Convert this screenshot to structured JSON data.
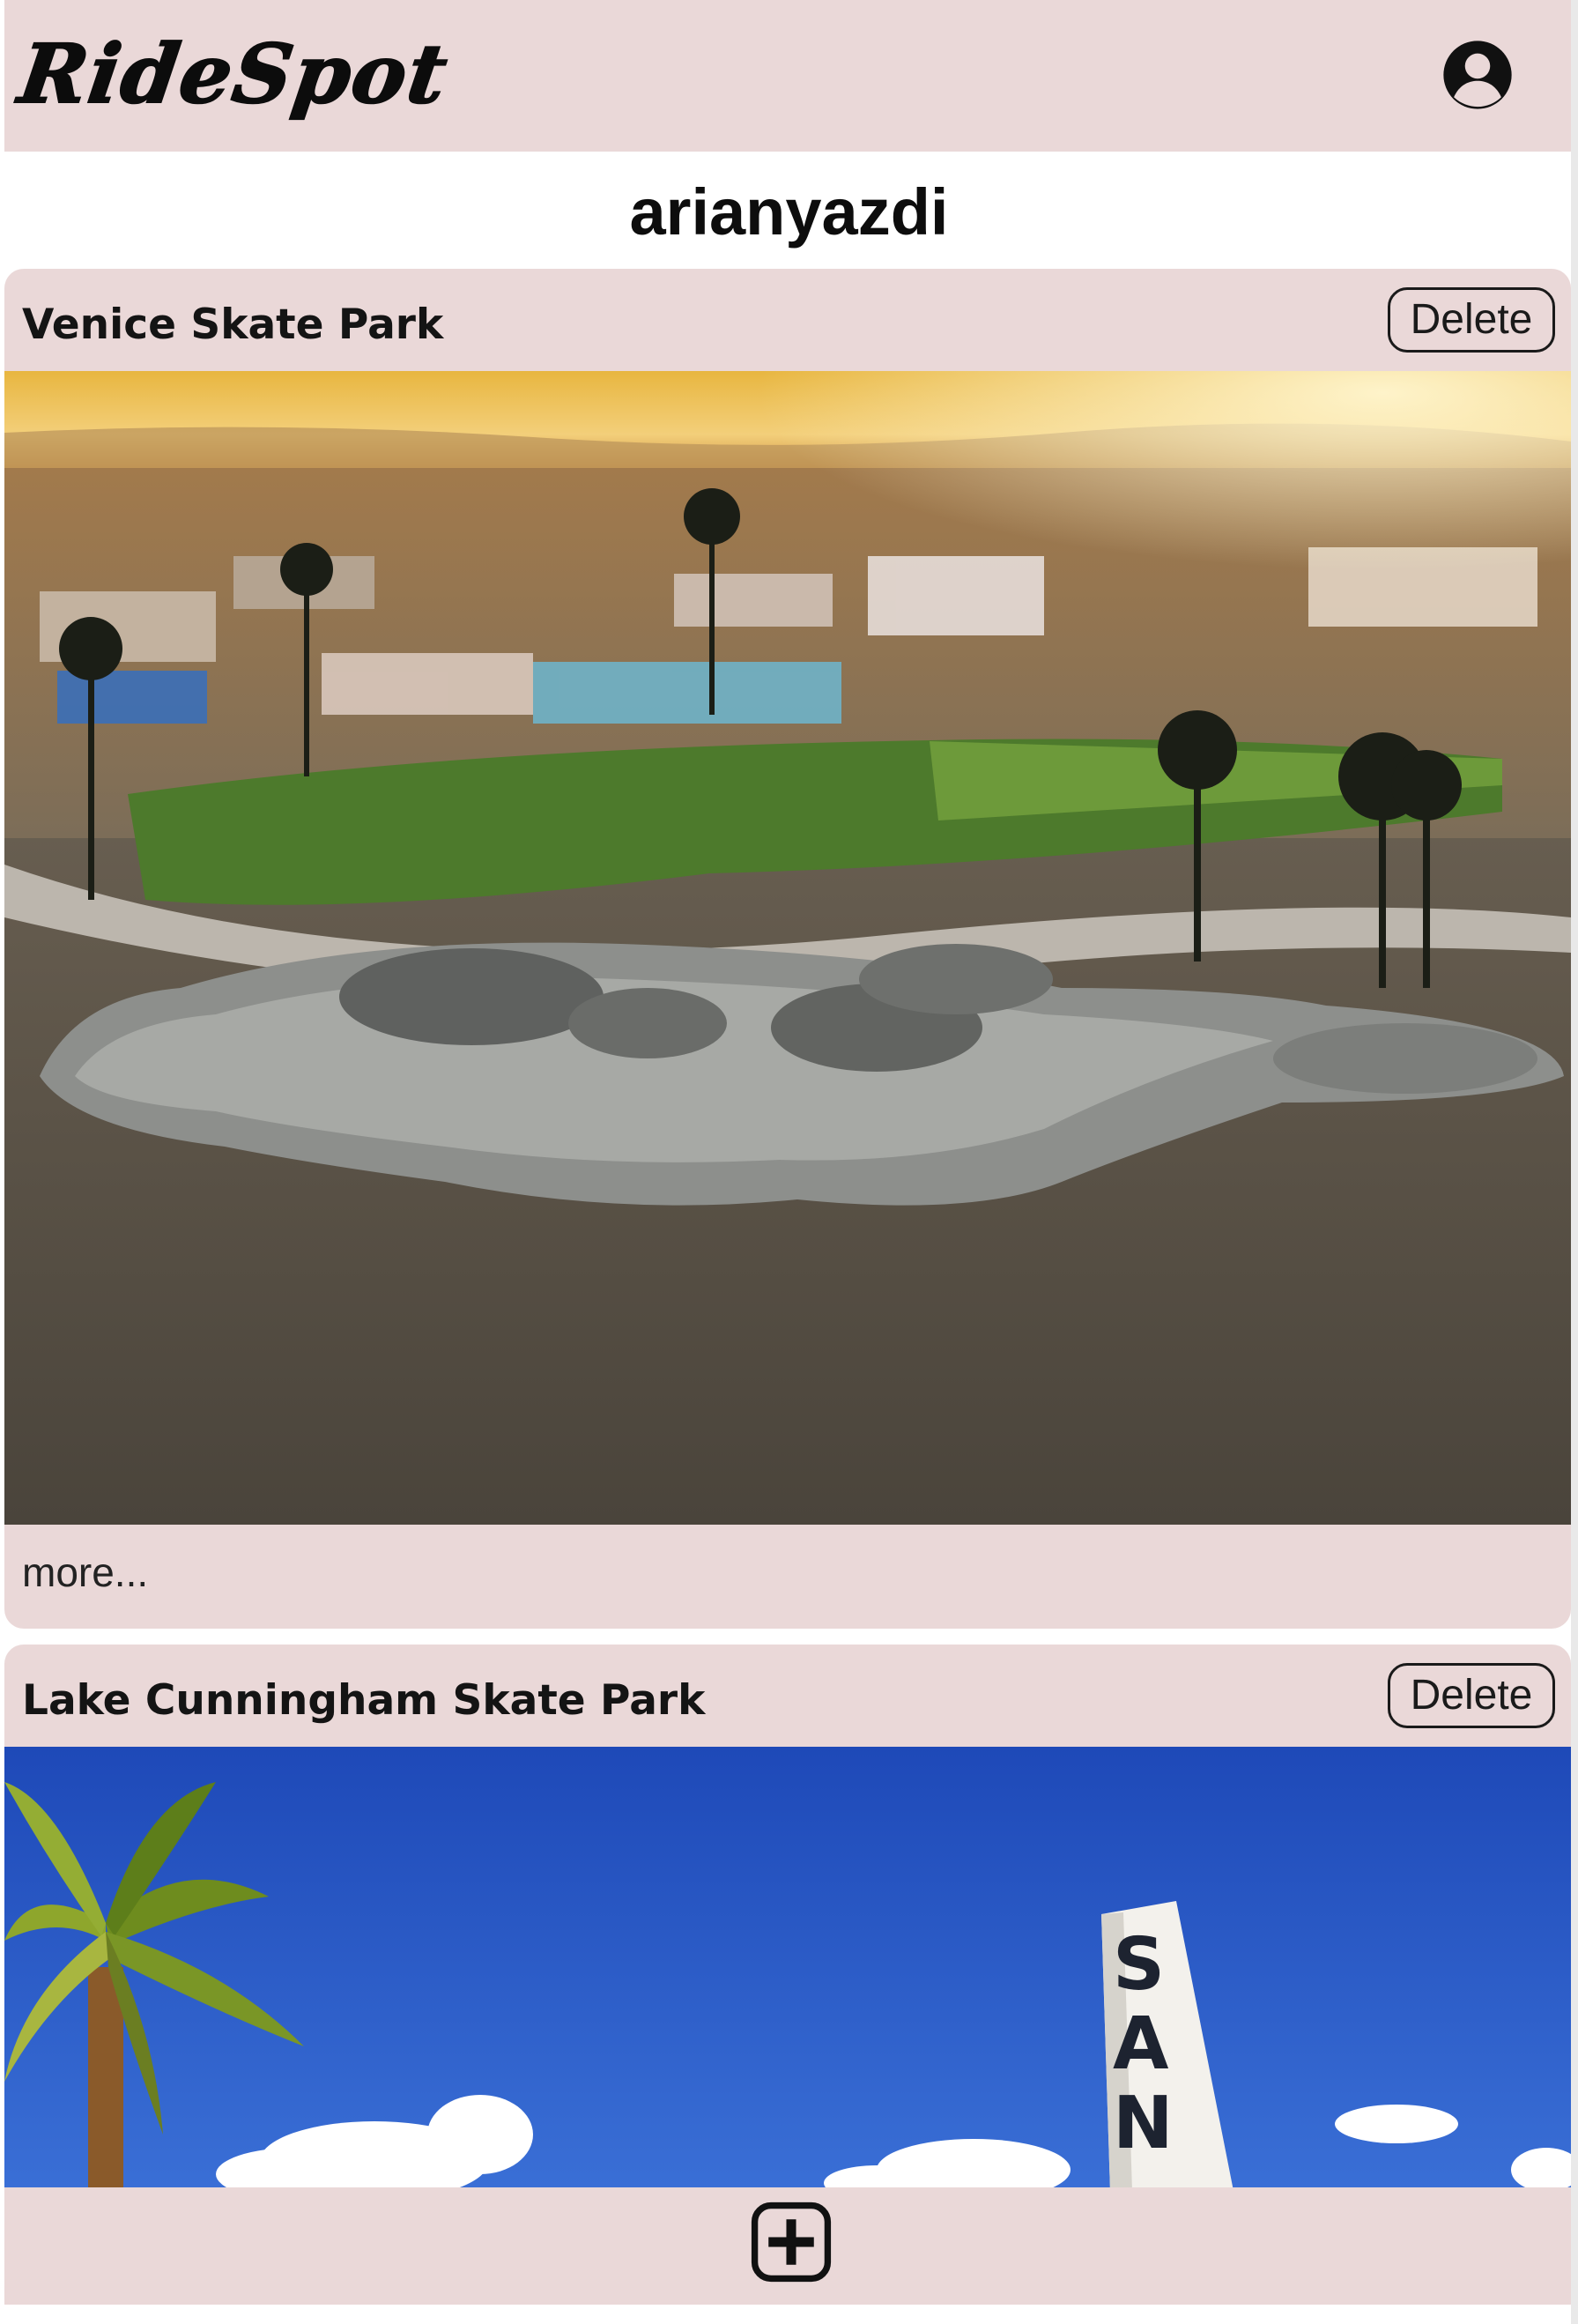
{
  "app": {
    "logo_text": "RideSpot",
    "account_icon": "user-circle-icon"
  },
  "profile": {
    "username": "arianyazdi"
  },
  "spots": [
    {
      "title": "Venice Skate Park",
      "delete_label": "Delete",
      "image_subject": "aerial-skatepark-beach-sunset",
      "more_label": "more..."
    },
    {
      "title": "Lake Cunningham Skate Park",
      "delete_label": "Delete",
      "image_subject": "palm-tree-blue-sky-sign"
    }
  ],
  "footer": {
    "add_icon": "plus-square-icon"
  },
  "colors": {
    "bar_background": "#ead8d8",
    "page_background": "#ffffff",
    "text": "#111111"
  }
}
